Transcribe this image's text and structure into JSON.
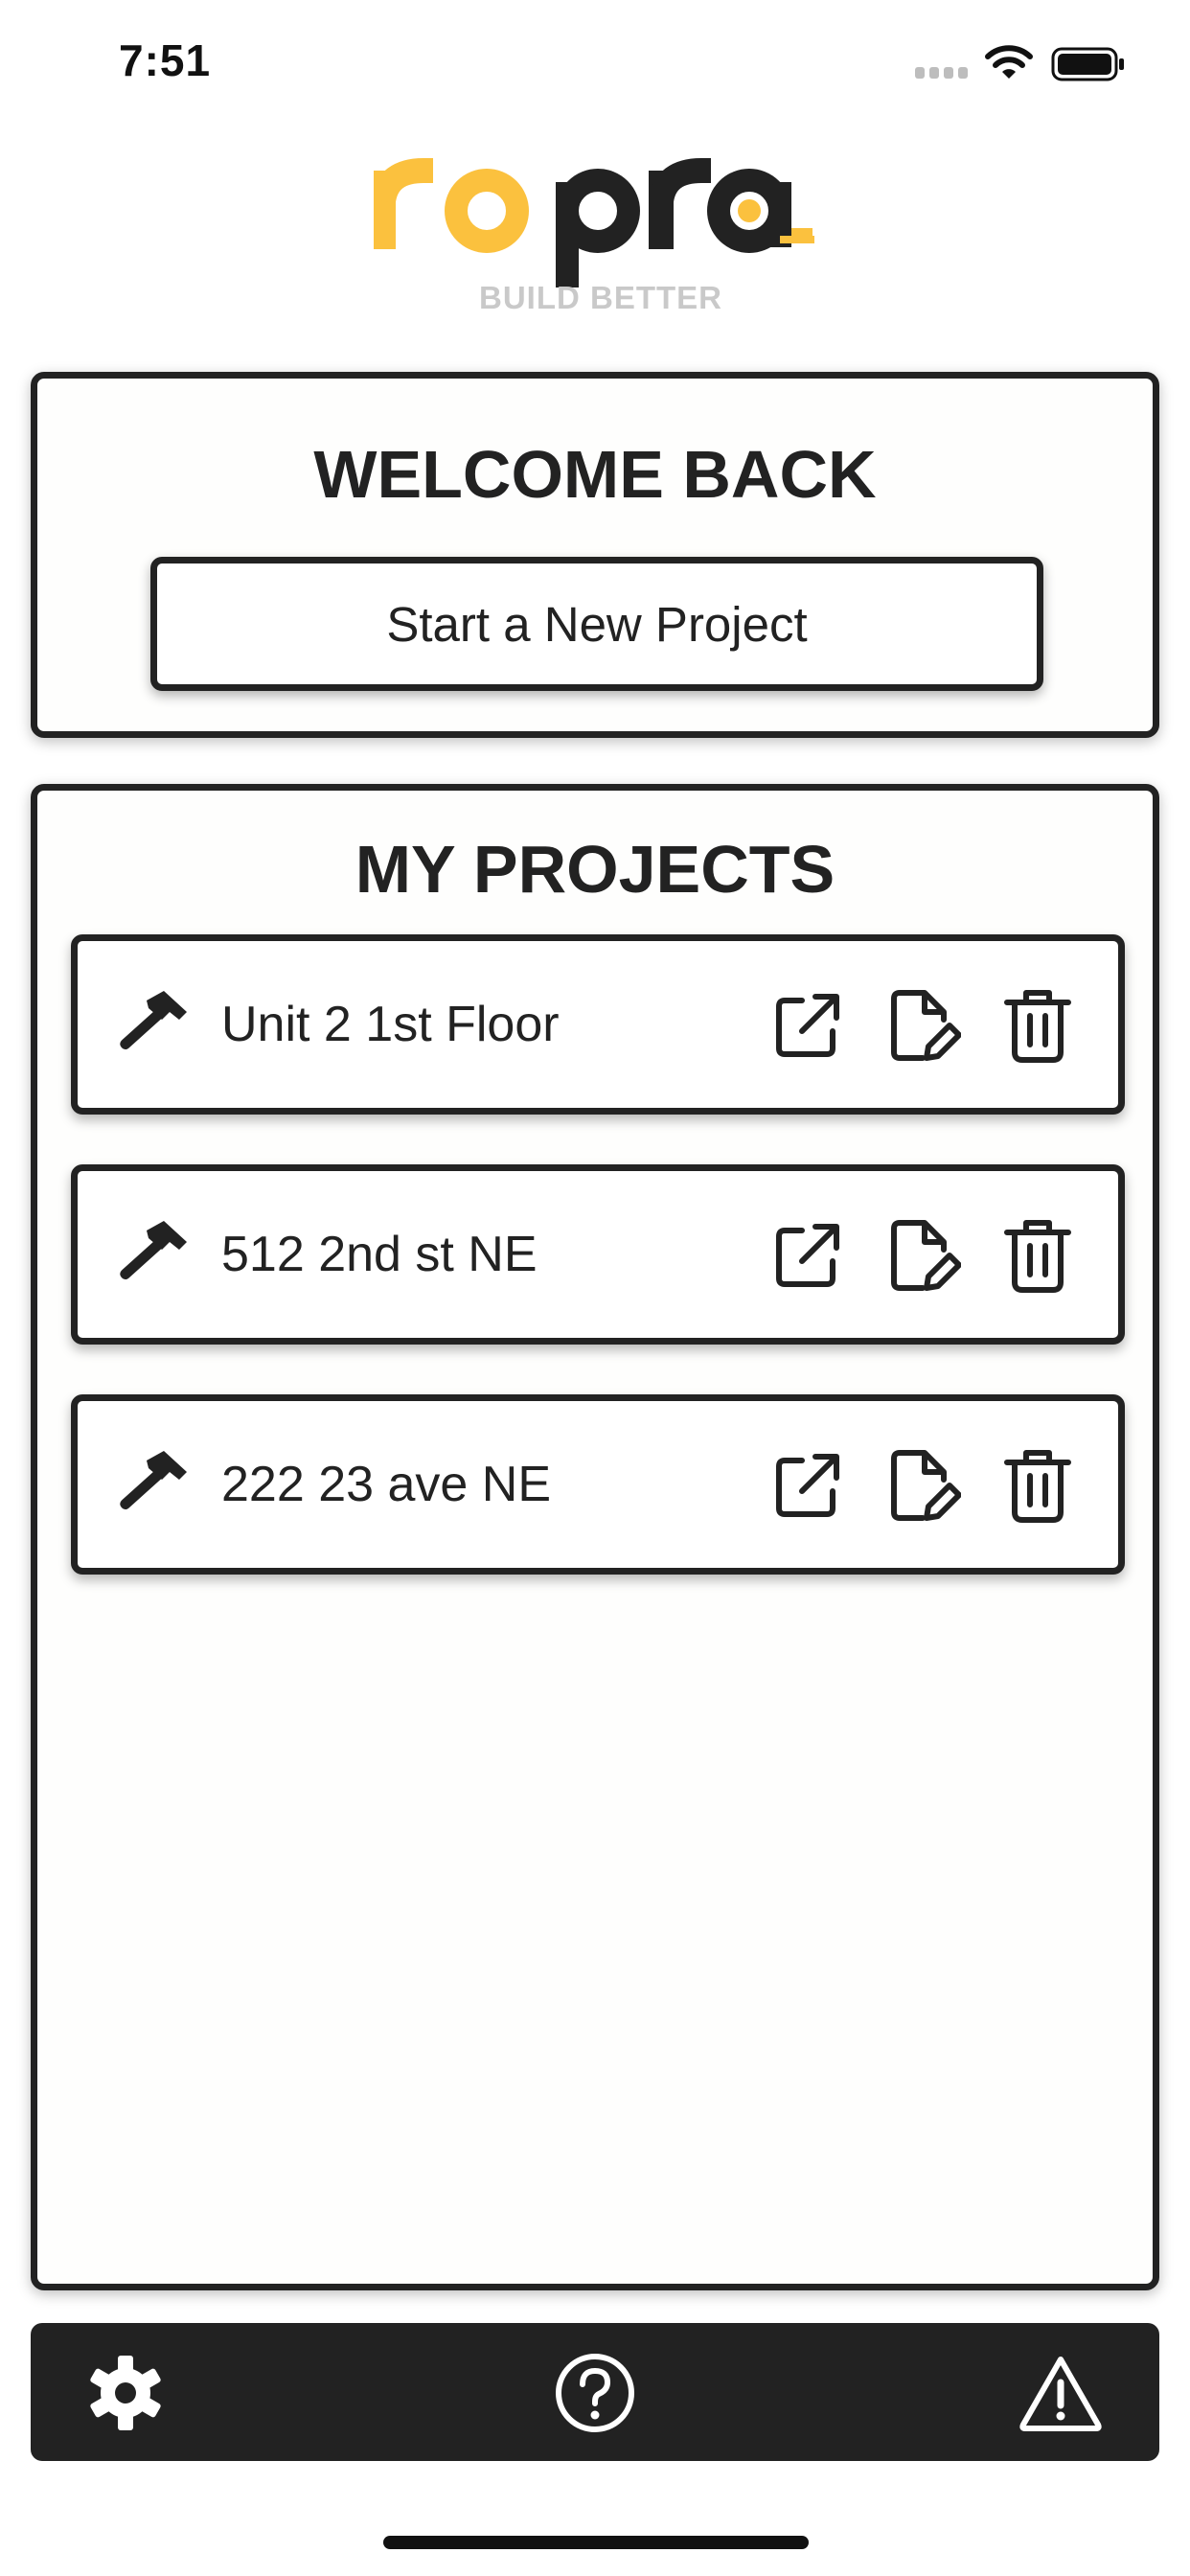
{
  "status_bar": {
    "time": "7:51"
  },
  "logo": {
    "wordmark": "ropra",
    "tagline": "BUILD BETTER"
  },
  "welcome": {
    "title": "WELCOME BACK",
    "new_project_label": "Start a New Project"
  },
  "projects": {
    "title": "MY PROJECTS",
    "items": [
      {
        "name": "Unit 2 1st Floor",
        "icon": "hammer-icon"
      },
      {
        "name": "512 2nd st NE",
        "icon": "hammer-icon"
      },
      {
        "name": "222 23 ave NE",
        "icon": "hammer-icon"
      }
    ],
    "actions": [
      "open-external-icon",
      "edit-document-icon",
      "trash-icon"
    ]
  },
  "bottom_bar": {
    "icons": [
      "gear-icon",
      "help-icon",
      "warning-icon"
    ]
  },
  "colors": {
    "brand_yellow": "#FBC13E",
    "dark": "#222222",
    "tagline_gray": "#C9C9C9"
  }
}
